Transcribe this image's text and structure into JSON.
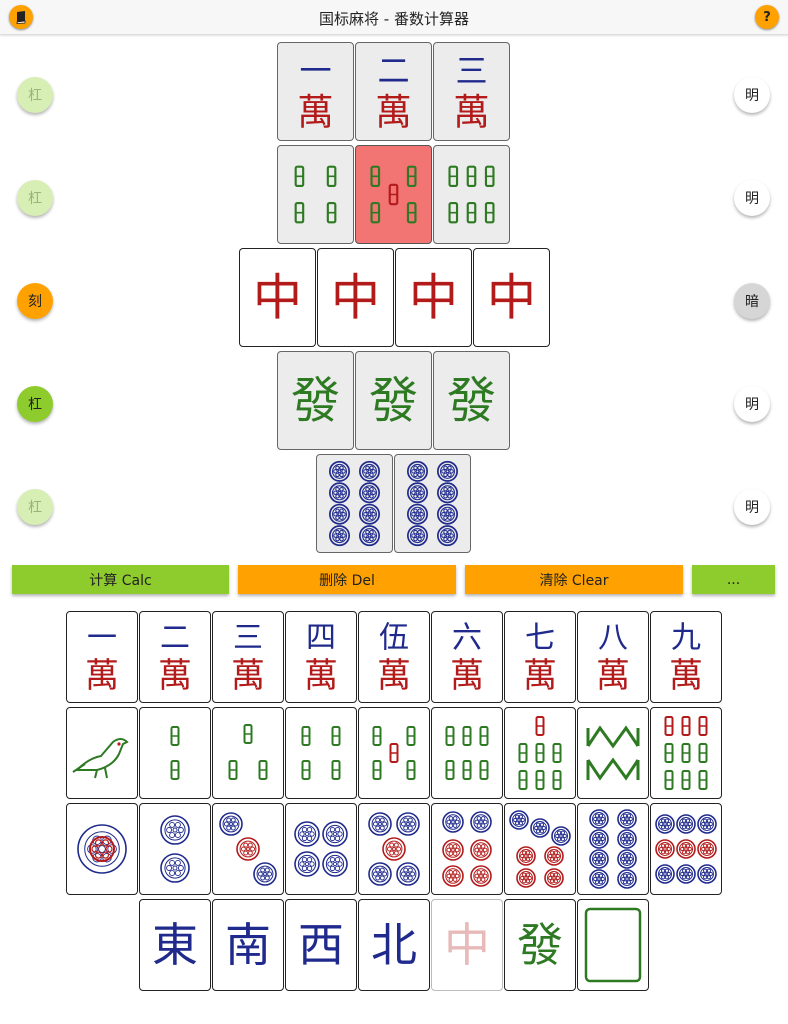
{
  "app": {
    "title": "国标麻将 - 番数计算器",
    "left_icon": "book-icon",
    "right_icon": "help-icon",
    "help_label": "?"
  },
  "colors": {
    "accent_orange": "#ffa100",
    "accent_green": "#8ecb2c",
    "tile_red": "#b31b1b",
    "tile_blue": "#1f2a8c",
    "tile_green": "#2e7a23",
    "selected_tile": "#f27574"
  },
  "hand": {
    "rows": [
      {
        "left_label": "杠",
        "left_state": "faded",
        "right_label": "明",
        "tiles": [
          "一萬",
          "二萬",
          "三萬"
        ]
      },
      {
        "left_label": "杠",
        "left_state": "faded",
        "right_label": "明",
        "tiles": [
          "4 bamboo",
          "5 bamboo (selected)",
          "6 bamboo"
        ]
      },
      {
        "left_label": "刻",
        "left_state": "orange",
        "right_label": "暗",
        "tiles": [
          "中",
          "中",
          "中",
          "中"
        ]
      },
      {
        "left_label": "杠",
        "left_state": "green",
        "right_label": "明",
        "tiles": [
          "發",
          "發",
          "發"
        ]
      },
      {
        "left_label": "杠",
        "left_state": "faded",
        "right_label": "明",
        "tiles": [
          "8 dots",
          "8 dots"
        ]
      }
    ]
  },
  "actions": {
    "calc": "计算 Calc",
    "del": "删除 Del",
    "clear": "清除 Clear",
    "more": "..."
  },
  "palette": {
    "characters": [
      "一",
      "二",
      "三",
      "四",
      "伍",
      "六",
      "七",
      "八",
      "九"
    ],
    "characters_suffix": "萬",
    "bamboo": [
      "1 bamboo (bird)",
      "2",
      "3",
      "4",
      "5",
      "6",
      "7",
      "8",
      "9"
    ],
    "dots": [
      "1",
      "2",
      "3",
      "4",
      "5",
      "6",
      "7",
      "8",
      "9"
    ],
    "honors": [
      "東",
      "南",
      "西",
      "北",
      "中",
      "發",
      "白"
    ]
  }
}
